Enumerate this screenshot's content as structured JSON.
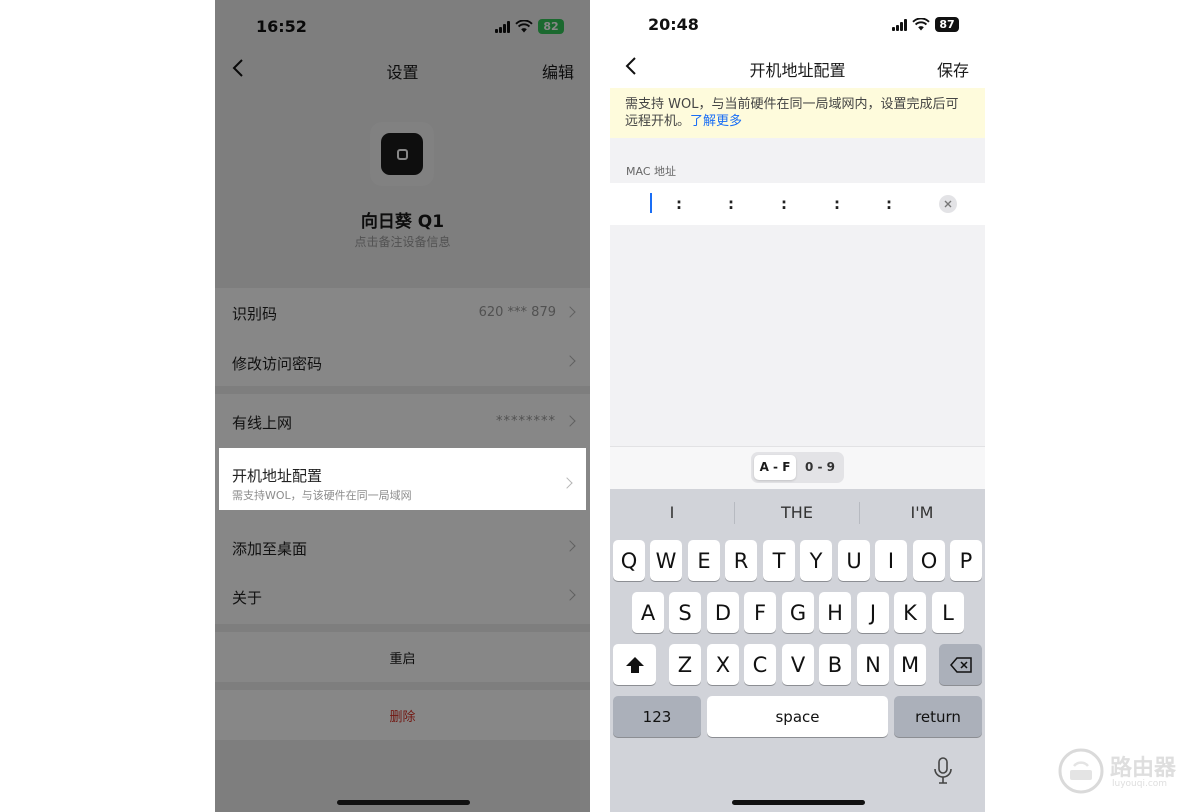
{
  "left": {
    "status": {
      "time": "16:52",
      "battery": "82"
    },
    "nav": {
      "title": "设置",
      "action": "编辑"
    },
    "device": {
      "name": "向日葵 Q1",
      "hint": "点击备注设备信息"
    },
    "rows": {
      "id": {
        "label": "识别码",
        "value": "620 *** 879"
      },
      "password": {
        "label": "修改访问密码"
      },
      "wired": {
        "label": "有线上网",
        "value": "********"
      },
      "boot": {
        "label": "开机地址配置",
        "sub": "需支持WOL，与该硬件在同一局域网"
      },
      "desktop": {
        "label": "添加至桌面"
      },
      "about": {
        "label": "关于"
      },
      "restart": {
        "label": "重启"
      },
      "delete": {
        "label": "删除"
      }
    }
  },
  "right": {
    "status": {
      "time": "20:48",
      "battery": "87"
    },
    "nav": {
      "title": "开机地址配置",
      "action": "保存"
    },
    "notice": {
      "text": "需支持 WOL，与当前硬件在同一局域网内，设置完成后可远程开机。",
      "link": "了解更多"
    },
    "mac": {
      "label": "MAC 地址",
      "separators": [
        ":",
        ":",
        ":",
        ":",
        ":"
      ]
    },
    "toggle": {
      "af": "A - F",
      "num": "0 - 9"
    },
    "keyboard": {
      "suggestions": [
        "I",
        "THE",
        "I'M"
      ],
      "row1": [
        "Q",
        "W",
        "E",
        "R",
        "T",
        "Y",
        "U",
        "I",
        "O",
        "P"
      ],
      "row2": [
        "A",
        "S",
        "D",
        "F",
        "G",
        "H",
        "J",
        "K",
        "L"
      ],
      "row3": [
        "Z",
        "X",
        "C",
        "V",
        "B",
        "N",
        "M"
      ],
      "numbers": "123",
      "space": "space",
      "return": "return"
    }
  },
  "watermark": {
    "text": "路由器",
    "url": "luyouqi.com"
  },
  "colors": {
    "accent": "#1a6ef5",
    "danger": "#d93025",
    "notice_bg": "#fefbdc",
    "battery_green": "#34c759"
  }
}
